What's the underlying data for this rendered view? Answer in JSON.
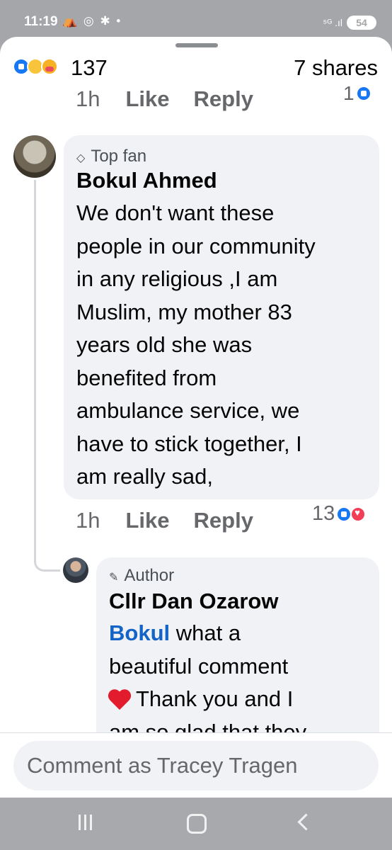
{
  "status_bar": {
    "time": "11:19",
    "left_icons": "⛺ ◎ ✱ •",
    "signal": "⁵ᴳ .ıl",
    "battery": "54"
  },
  "reactions": {
    "count": "137",
    "shares": "7 shares",
    "icons": [
      "like-icon",
      "sad-icon",
      "care-icon"
    ]
  },
  "prev_comment": {
    "time": "1h",
    "like_label": "Like",
    "reply_label": "Reply",
    "reaction_count": "1"
  },
  "comment": {
    "role_icon": "◇",
    "role": "Top fan",
    "name": "Bokul Ahmed",
    "lines": [
      "We don't want these",
      "people in our community",
      "in any religious ,I am",
      "Muslim, my mother 83",
      "years old she was",
      "benefited from",
      "ambulance service, we",
      "have to stick together, I",
      "am really sad,"
    ],
    "time": "1h",
    "like_label": "Like",
    "reply_label": "Reply",
    "reaction_count": "13"
  },
  "reply": {
    "role_icon": "✎",
    "role": "Author",
    "name": "Cllr Dan Ozarow",
    "mention": "Bokul",
    "line1_rest": " what a",
    "line2": "beautiful comment",
    "line3": "Thank you and I",
    "line4": "am so glad that they"
  },
  "composer": {
    "placeholder": "Comment as Tracey Tragen"
  }
}
